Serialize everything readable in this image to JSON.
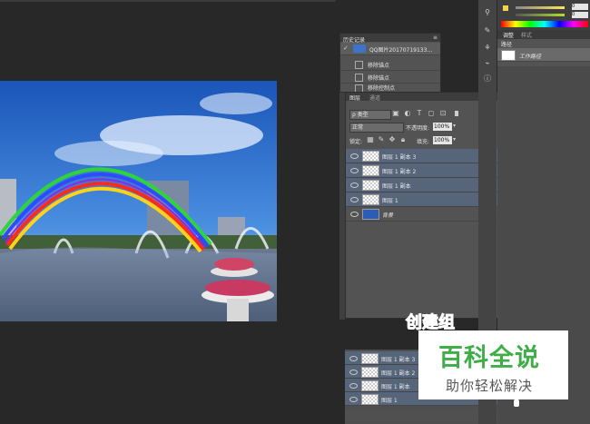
{
  "history_panel": {
    "title": "历史记录",
    "snapshot_name": "QQ图片20170719133...",
    "steps": [
      "移除锚点",
      "移除锚点",
      "移除控制点"
    ]
  },
  "layers_panel": {
    "tabs": [
      "图层",
      "通道"
    ],
    "filter_label": "ρ 类型",
    "blend_mode": "正常",
    "opacity_label": "不透明度:",
    "opacity_value": "100%",
    "lock_label": "锁定:",
    "fill_label": "填充:",
    "fill_value": "100%",
    "layers": [
      "图层 1 副本 3",
      "图层 1 副本 2",
      "图层 1 副本",
      "图层 1",
      "背景"
    ],
    "lower_layers": [
      "图层 1 副本 3",
      "图层 1 副本 2",
      "图层 1 副本",
      "图层 1"
    ]
  },
  "right_panel": {
    "tabs": [
      "调整",
      "样式"
    ],
    "paths_tab": "路径",
    "work_path": "工作路径",
    "color_slider_value": "0",
    "color_slider_value2": "0"
  },
  "overlay": {
    "annotation": "创建组",
    "watermark_title": "百科全说",
    "watermark_subtitle": "助你轻松解决"
  },
  "colors": {
    "annotation": "#e8272b",
    "watermark_green": "#3fae49",
    "selected_layer": "#56657a"
  }
}
